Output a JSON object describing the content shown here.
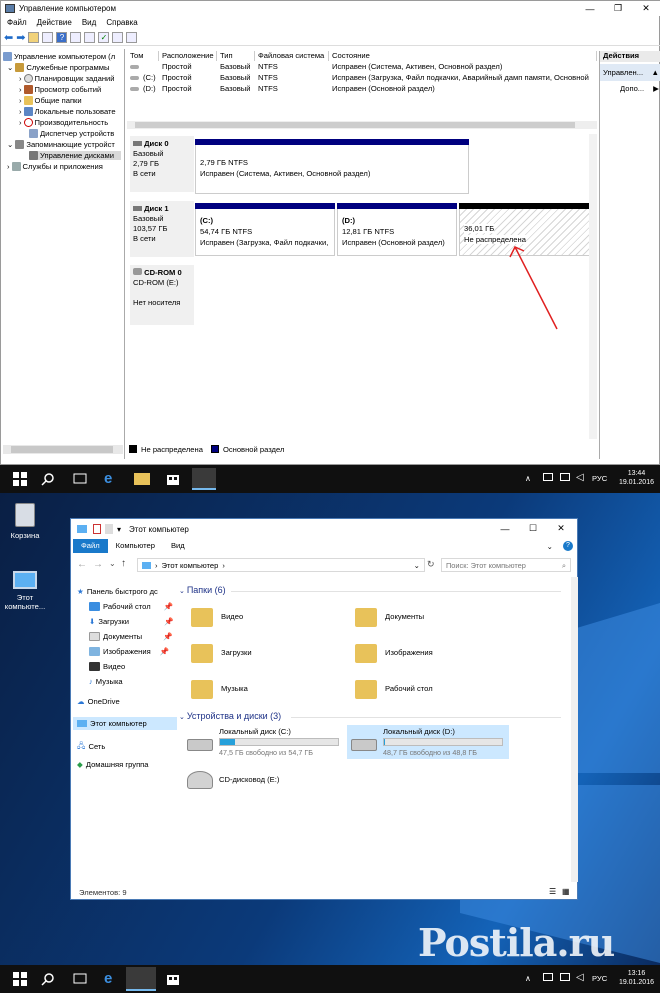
{
  "cm": {
    "title": "Управление компьютером",
    "menu": [
      "Файл",
      "Действие",
      "Вид",
      "Справка"
    ],
    "tree": [
      "Управление компьютером (л",
      "Служебные программы",
      "Планировщик заданий",
      "Просмотр событий",
      "Общие папки",
      "Локальные пользовате",
      "Производительность",
      "Диспетчер устройств",
      "Запоминающие устройст",
      "Управление дисками",
      "Службы и приложения"
    ],
    "columns": [
      "Том",
      "Расположение",
      "Тип",
      "Файловая система",
      "Состояние"
    ],
    "volumes": [
      {
        "name": "",
        "layout": "Простой",
        "type": "Базовый",
        "fs": "NTFS",
        "status": "Исправен (Система, Активен, Основной раздел)"
      },
      {
        "name": "(C:)",
        "layout": "Простой",
        "type": "Базовый",
        "fs": "NTFS",
        "status": "Исправен (Загрузка, Файл подкачки, Аварийный дамп памяти, Основной"
      },
      {
        "name": "(D:)",
        "layout": "Простой",
        "type": "Базовый",
        "fs": "NTFS",
        "status": "Исправен (Основной раздел)"
      }
    ],
    "disks": {
      "disk0": {
        "name": "Диск 0",
        "kind": "Базовый",
        "size": "2,79 ГБ",
        "state": "В сети",
        "part": {
          "size": "2,79 ГБ NTFS",
          "status": "Исправен (Система, Активен, Основной раздел)"
        }
      },
      "disk1": {
        "name": "Диск 1",
        "kind": "Базовый",
        "size": "103,57 ГБ",
        "state": "В сети",
        "c": {
          "label": "(C:)",
          "size": "54,74 ГБ NTFS",
          "status": "Исправен (Загрузка, Файл подкачки,"
        },
        "d": {
          "label": "(D:)",
          "size": "12,81 ГБ NTFS",
          "status": "Исправен (Основной раздел)"
        },
        "free": {
          "size": "36,01 ГБ",
          "status": "Не распределена"
        }
      },
      "cdrom": {
        "name": "CD-ROM 0",
        "drive": "CD-ROM (E:)",
        "state": "Нет носителя"
      }
    },
    "legend": {
      "unalloc": "Не распределена",
      "primary": "Основной раздел"
    },
    "actions": {
      "header": "Действия",
      "selected": "Управлен...",
      "more": "Допо..."
    }
  },
  "taskbar1": {
    "lang": "РУС",
    "time": "13:44",
    "date": "19.01.2016"
  },
  "desktop": {
    "recycle": "Корзина",
    "computer_line1": "Этот",
    "computer_line2": "компьюте..."
  },
  "explorer": {
    "title": "Этот компьютер",
    "tabs": [
      "Файл",
      "Компьютер",
      "Вид"
    ],
    "address": "Этот компьютер",
    "search_placeholder": "Поиск: Этот компьютер",
    "nav": [
      "Панель быстрого дс",
      "Рабочий стол",
      "Загрузки",
      "Документы",
      "Изображения",
      "Видео",
      "Музыка",
      "OneDrive",
      "Этот компьютер",
      "Сеть",
      "Домашняя группа"
    ],
    "folders_header": "Папки (6)",
    "folders": [
      "Видео",
      "Документы",
      "Загрузки",
      "Изображения",
      "Музыка",
      "Рабочий стол"
    ],
    "devices_header": "Устройства и диски (3)",
    "drives": [
      {
        "name": "Локальный диск (C:)",
        "free": "47,5 ГБ свободно из 54,7 ГБ",
        "used_fraction": 0.13
      },
      {
        "name": "Локальный диск (D:)",
        "free": "48,7 ГБ свободно из 48,8 ГБ",
        "used_fraction": 0.01
      },
      {
        "name": "CD-дисковод (E:)"
      }
    ],
    "status": "Элементов: 9"
  },
  "taskbar2": {
    "lang": "РУС",
    "time": "13:16",
    "date": "19.01.2016"
  },
  "watermark": "Postila.ru"
}
